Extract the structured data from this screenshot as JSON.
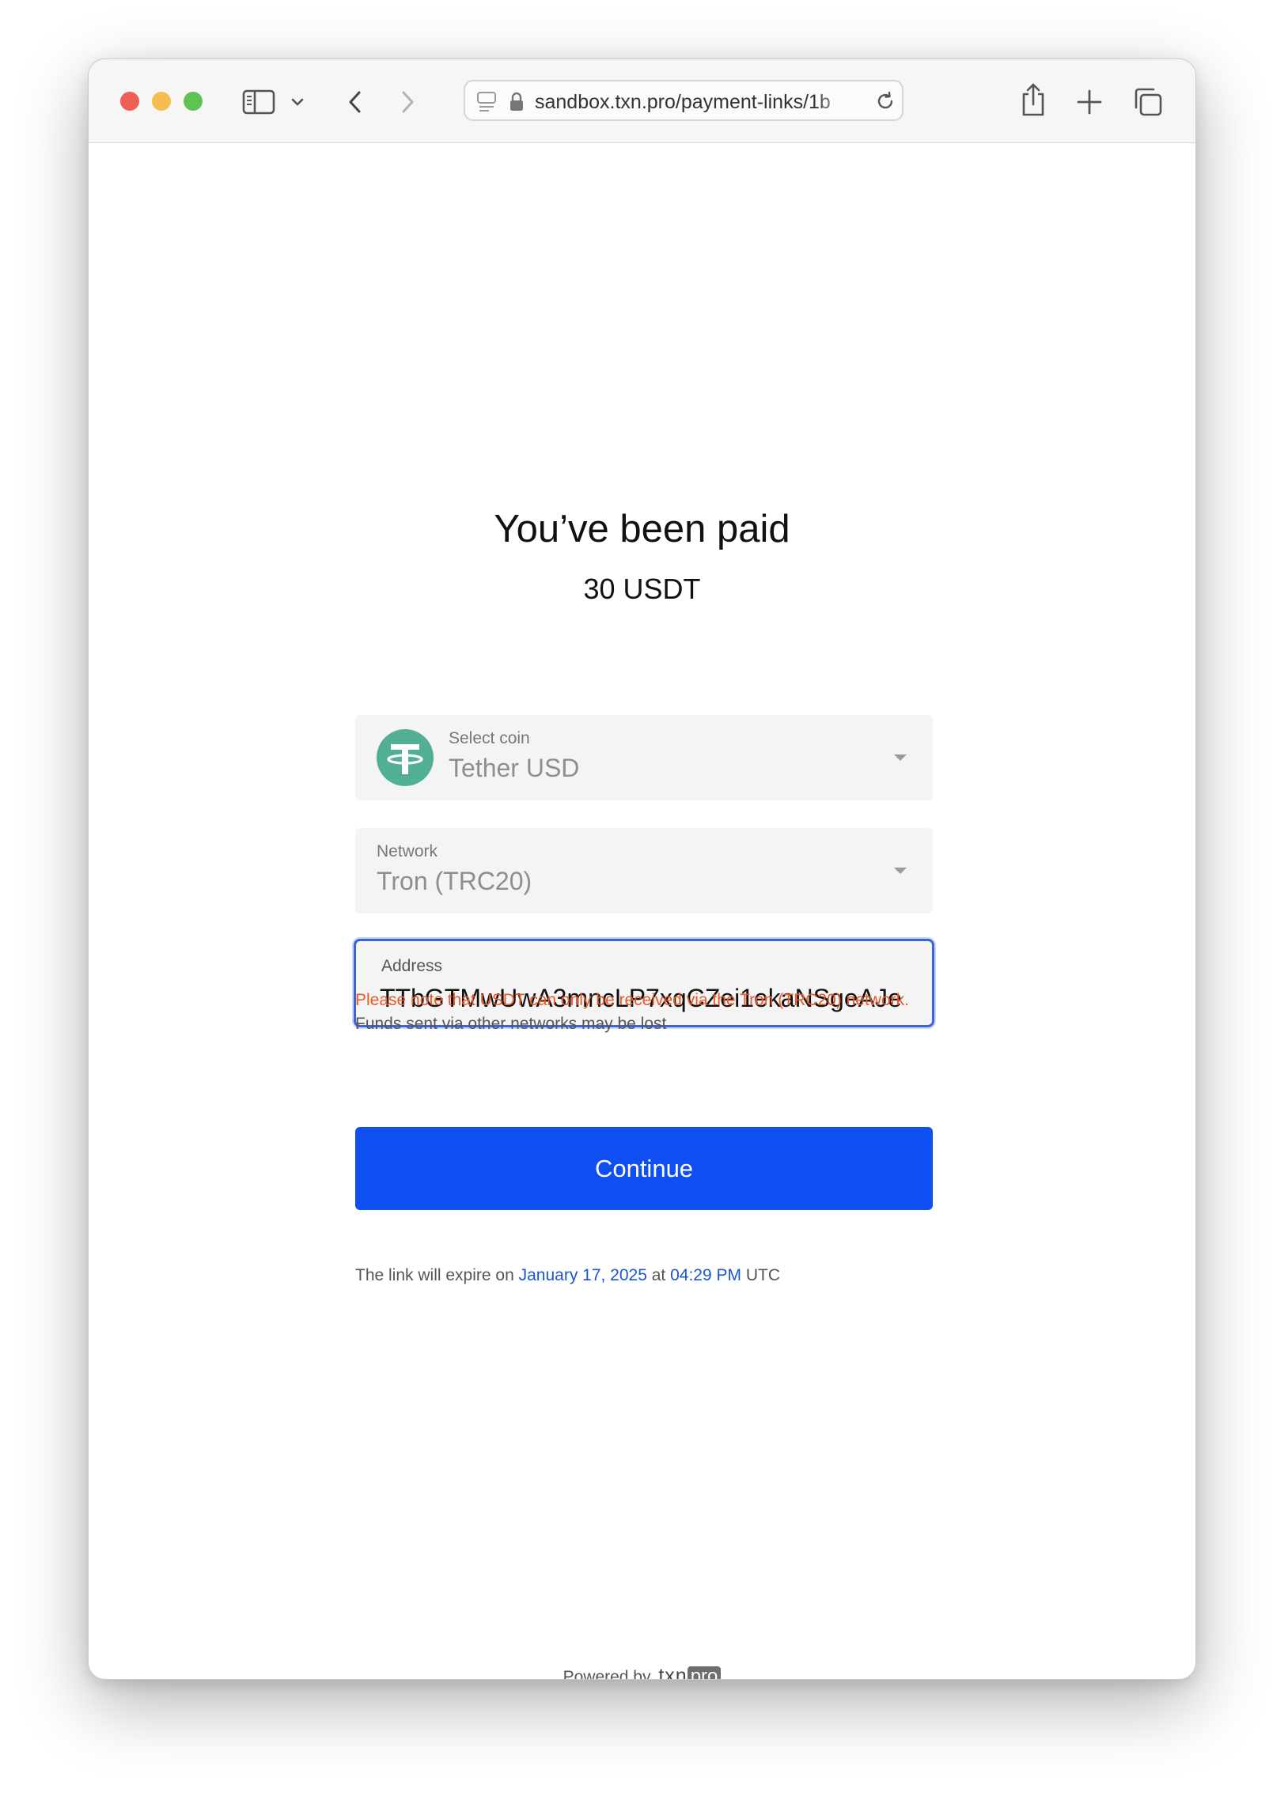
{
  "browser": {
    "url": "sandbox.txn.pro/payment-links/1b"
  },
  "page": {
    "title": "You’ve been paid",
    "amount": "30 USDT",
    "coin_select": {
      "label": "Select coin",
      "value": "Tether USD",
      "icon": "tether-icon",
      "icon_color": "#50af95"
    },
    "network_select": {
      "label": "Network",
      "value": "Tron (TRC20)"
    },
    "address_field": {
      "label": "Address",
      "value": "TTbGTMwUwA3mncLP7xqCZei1ekaNSgeAJe"
    },
    "warning": "Please note that USDT can only be received via the Tron (TRC20) network.",
    "subnote": "Funds sent via other networks may be lost",
    "continue_label": "Continue",
    "expiry": {
      "prefix": "The link will expire on",
      "date": "January 17, 2025",
      "mid": "at",
      "time": "04:29 PM",
      "suffix": "UTC"
    },
    "footer": {
      "powered_by": "Powered by",
      "brand": "txn",
      "brand_suffix": "pro"
    }
  },
  "colors": {
    "primary": "#0f4ef1",
    "warning": "#e85a2a",
    "link": "#1a55d6"
  }
}
